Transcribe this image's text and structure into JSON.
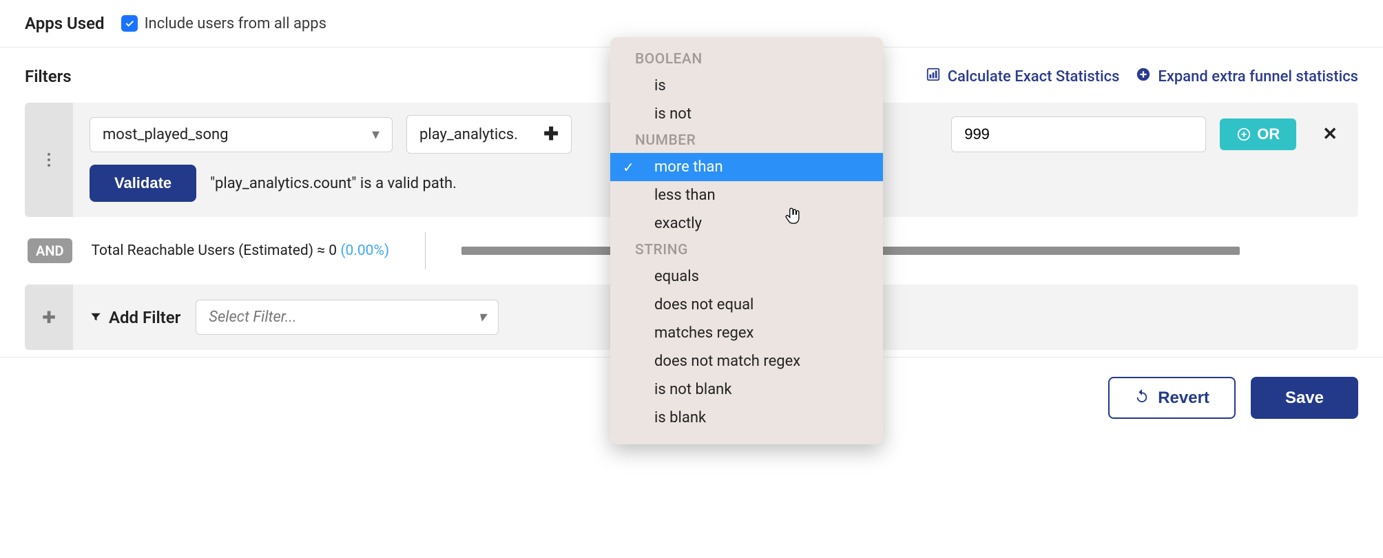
{
  "apps_used": {
    "heading": "Apps Used",
    "checkbox_label": "Include users from all apps",
    "checkbox_checked": true
  },
  "filters": {
    "heading": "Filters",
    "calc_link": "Calculate Exact Statistics",
    "expand_link": "Expand extra funnel statistics",
    "row": {
      "field_select": "most_played_song",
      "path_select": "play_analytics.",
      "operator_select": "more than",
      "value": "999",
      "or_label": "OR",
      "validate_label": "Validate",
      "valid_message": "\"play_analytics.count\" is a valid path."
    },
    "and_badge": "AND",
    "reach_text": "Total Reachable Users (Estimated) ≈ 0 ",
    "reach_pct": "(0.00%)",
    "add_filter_label": "Add Filter",
    "add_filter_placeholder": "Select Filter..."
  },
  "dropdown": {
    "groups": [
      {
        "label": "BOOLEAN",
        "items": [
          {
            "label": "is",
            "selected": false
          },
          {
            "label": "is not",
            "selected": false
          }
        ]
      },
      {
        "label": "NUMBER",
        "items": [
          {
            "label": "more than",
            "selected": true
          },
          {
            "label": "less than",
            "selected": false
          },
          {
            "label": "exactly",
            "selected": false
          }
        ]
      },
      {
        "label": "STRING",
        "items": [
          {
            "label": "equals",
            "selected": false
          },
          {
            "label": "does not equal",
            "selected": false
          },
          {
            "label": "matches regex",
            "selected": false
          },
          {
            "label": "does not match regex",
            "selected": false
          },
          {
            "label": "is not blank",
            "selected": false
          },
          {
            "label": "is blank",
            "selected": false
          }
        ]
      }
    ]
  },
  "footer": {
    "revert": "Revert",
    "save": "Save"
  }
}
